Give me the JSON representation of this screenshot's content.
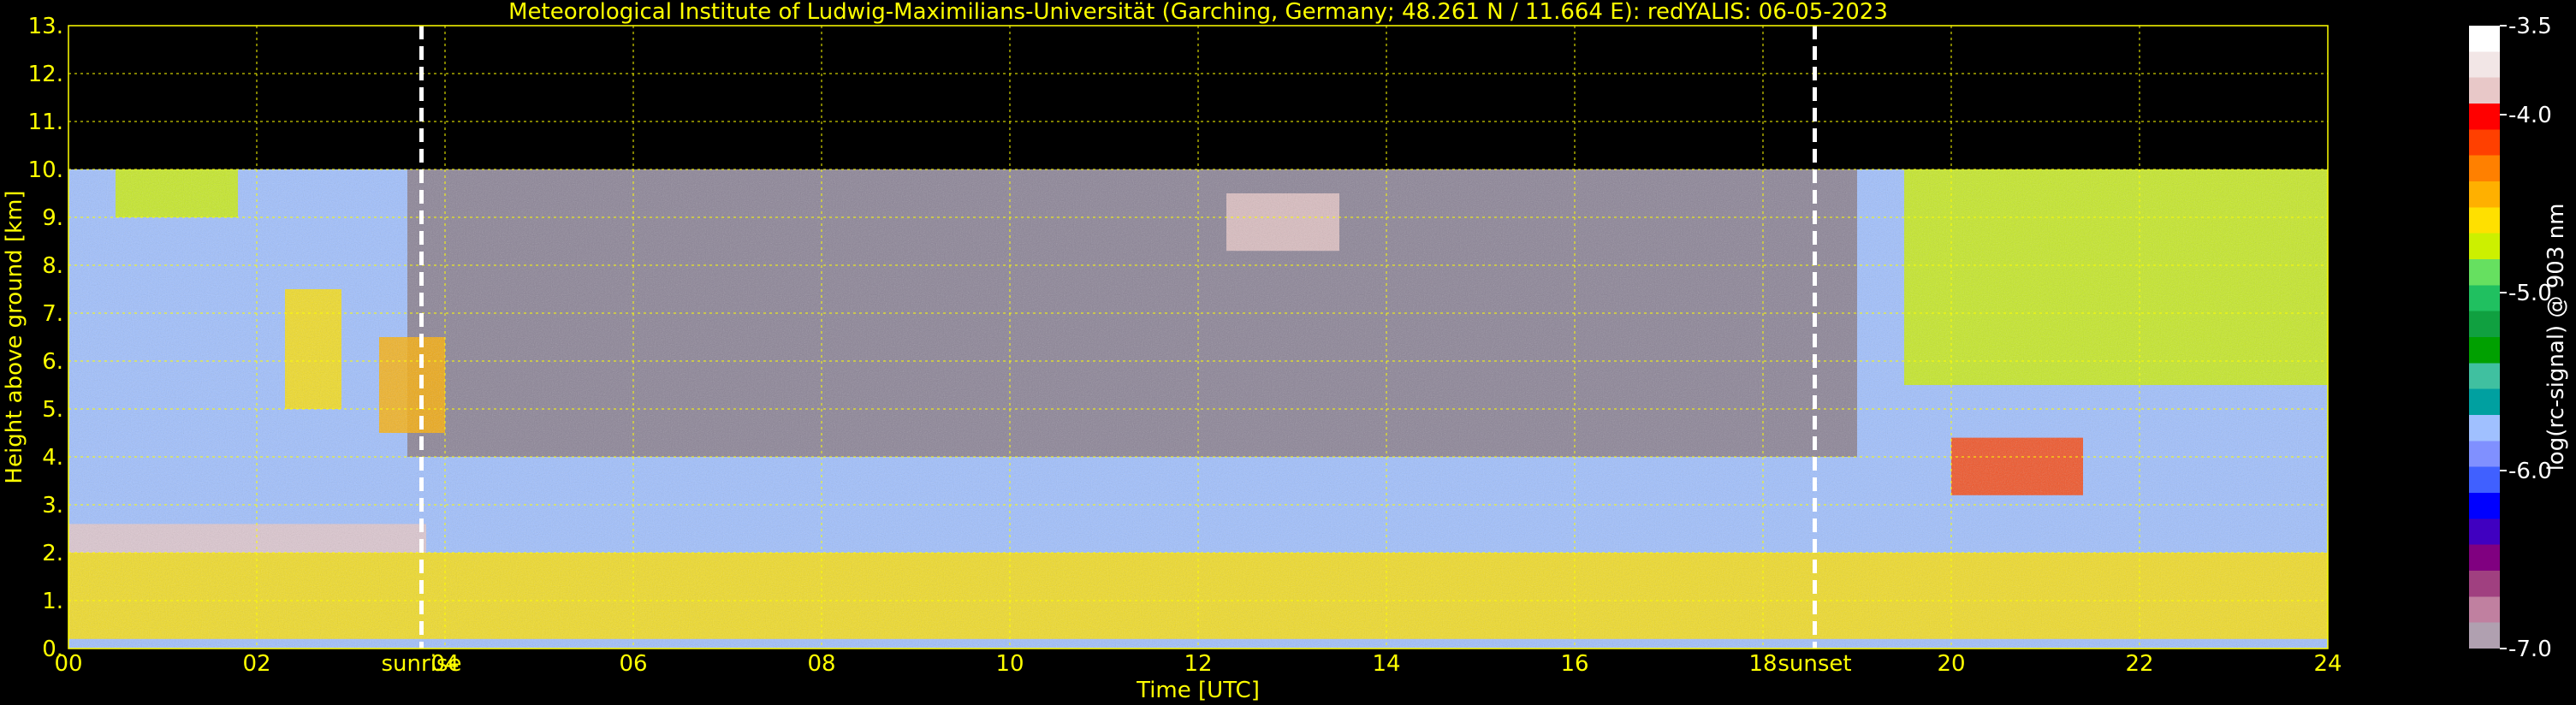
{
  "chart_data": {
    "type": "heatmap",
    "title": "Meteorological Institute of Ludwig-Maximilians-Universität (Garching, Germany; 48.261 N / 11.664 E):    redYALIS: 06-05-2023",
    "xlabel": "Time [UTC]",
    "ylabel": "Height above ground [km]",
    "xlim": [
      0,
      24
    ],
    "ylim": [
      0,
      13
    ],
    "x_ticks": [
      "00",
      "02",
      "04",
      "06",
      "08",
      "10",
      "12",
      "14",
      "16",
      "18",
      "20",
      "22",
      "24"
    ],
    "y_ticks": [
      "0.",
      "1.",
      "2.",
      "3.",
      "4.",
      "5.",
      "6.",
      "7.",
      "8.",
      "9.",
      "10.",
      "11.",
      "12.",
      "13."
    ],
    "grid": true,
    "data_top_km": 10,
    "events": [
      {
        "label": "sunrise",
        "x": 3.75
      },
      {
        "label": "sunset",
        "x": 18.55
      }
    ],
    "colorbar": {
      "label": "log(rc-signal) @ 903 nm",
      "range": [
        -7.0,
        -3.5
      ],
      "ticks": [
        "-3.5",
        "-4.0",
        "-5.0",
        "-6.0",
        "-7.0"
      ],
      "tick_values": [
        -3.5,
        -4.0,
        -5.0,
        -6.0,
        -7.0
      ],
      "colors": [
        "#ffffff",
        "#f2e6e6",
        "#e8c8c8",
        "#ff0000",
        "#ff4000",
        "#ff8000",
        "#ffb000",
        "#ffe000",
        "#ccf000",
        "#66e060",
        "#20c060",
        "#10a040",
        "#00a000",
        "#40c0a0",
        "#00a0a0",
        "#a0c0ff",
        "#8090ff",
        "#4060ff",
        "#0000ff",
        "#4000c0",
        "#800080",
        "#a04080",
        "#c080a0",
        "#b0a0b0"
      ]
    },
    "features": [
      {
        "kind": "aerosol_layer",
        "x_range": [
          0,
          24
        ],
        "y_range": [
          0.2,
          2.0
        ],
        "level": -4.6
      },
      {
        "kind": "cloud",
        "x_range": [
          0.5,
          1.8
        ],
        "y_range": [
          9.0,
          10.0
        ],
        "level": -4.8
      },
      {
        "kind": "cloud",
        "x_range": [
          2.3,
          2.9
        ],
        "y_range": [
          5.0,
          7.5
        ],
        "level": -4.6
      },
      {
        "kind": "cloud",
        "x_range": [
          3.3,
          4.0
        ],
        "y_range": [
          4.5,
          6.5
        ],
        "level": -4.4
      },
      {
        "kind": "cloud",
        "x_range": [
          12.3,
          13.5
        ],
        "y_range": [
          8.3,
          9.5
        ],
        "level": -3.8
      },
      {
        "kind": "cloud",
        "x_range": [
          19.5,
          24.0
        ],
        "y_range": [
          5.5,
          10.0
        ],
        "level": -4.7
      },
      {
        "kind": "cloud",
        "x_range": [
          20.0,
          21.4
        ],
        "y_range": [
          3.2,
          4.4
        ],
        "level": -4.2
      },
      {
        "kind": "cloud_base_line",
        "x_range": [
          0,
          3.8
        ],
        "y_range": [
          2.0,
          2.6
        ],
        "level": -3.8
      }
    ]
  }
}
